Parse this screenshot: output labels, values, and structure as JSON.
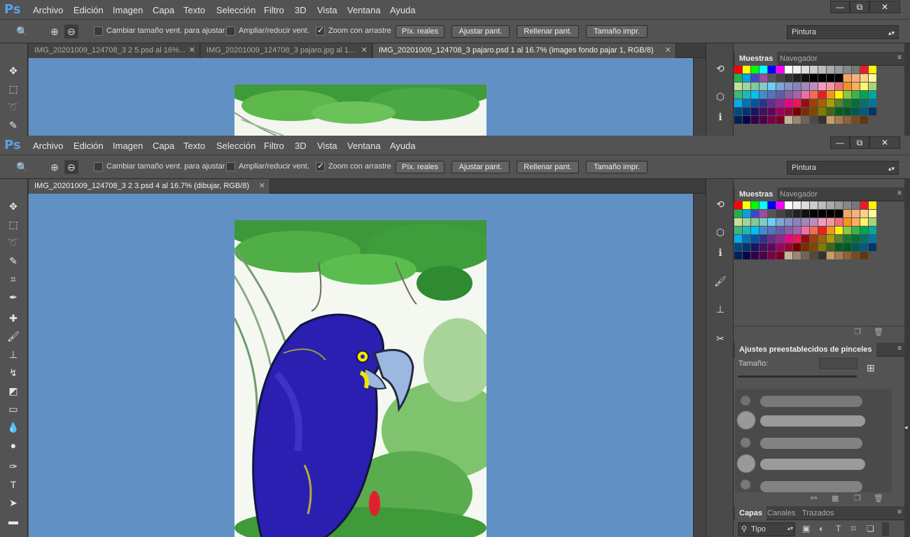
{
  "app": {
    "logo": "Ps"
  },
  "menu": [
    "Archivo",
    "Edición",
    "Imagen",
    "Capa",
    "Texto",
    "Selección",
    "Filtro",
    "3D",
    "Vista",
    "Ventana",
    "Ayuda"
  ],
  "window_buttons": {
    "minimize": "—",
    "restore": "⧉",
    "close": "✕"
  },
  "options": {
    "resize_windows": "Cambiar tamaño vent. para ajustar",
    "zoom_all": "Ampliar/reducir vent.",
    "scrubby_zoom": "Zoom con arrastre",
    "actual_pixels": "Píx. reales",
    "fit_screen": "Ajustar pant.",
    "fill_screen": "Rellenar pant.",
    "print_size": "Tamaño impr.",
    "workspace": "Pintura"
  },
  "back_window": {
    "tabs": [
      {
        "label": "IMG_20201009_124708_3 2 5.psd al 16%...",
        "active": false
      },
      {
        "label": "IMG_20201009_124708_3 pajaro.jpg al 1...",
        "active": false
      },
      {
        "label": "IMG_20201009_124708_3 pajaro.psd 1 al 16.7% (images fondo pajar 1, RGB/8)",
        "active": true
      }
    ]
  },
  "front_window": {
    "tabs": [
      {
        "label": "IMG_20201009_124708_3 2 3.psd 4 al 16.7% (dibujar, RGB/8)",
        "active": true
      }
    ]
  },
  "panels": {
    "swatches_tab": "Muestras",
    "navigator_tab": "Navegador",
    "brush_presets_title": "Ajustes preestablecidos de pinceles",
    "size_label": "Tamaño:",
    "layers_tab": "Capas",
    "channels_tab": "Canales",
    "paths_tab": "Trazados",
    "kind_filter": "Tipo"
  },
  "colors": {
    "ui_bg": "#535353",
    "canvas_bg": "#6190c4",
    "accent_logo": "#5aa0e6"
  },
  "swatches": [
    [
      "#ff0000",
      "#ffff00",
      "#00ff00",
      "#00ffff",
      "#0000ff",
      "#ff00ff",
      "#ffffff",
      "#eeeeee",
      "#dddddd",
      "#cccccc",
      "#bbbbbb",
      "#aaaaaa",
      "#999999",
      "#888888",
      "#777777",
      "#ed1c24",
      "#fff200"
    ],
    [
      "#22b14c",
      "#00a2e8",
      "#3f48cc",
      "#a349a4",
      "#555555",
      "#444444",
      "#333333",
      "#222222",
      "#111111",
      "#000000",
      "#000000",
      "#000000",
      "#000000",
      "#f4a460",
      "#fbb07c",
      "#fdd38a",
      "#fff799"
    ],
    [
      "#c4df9b",
      "#a2d39c",
      "#82ca9d",
      "#7bcdc8",
      "#6ecff6",
      "#7ea7d8",
      "#8493ca",
      "#8882be",
      "#a187be",
      "#bc8dbf",
      "#f49ac1",
      "#f5989d",
      "#f26d7d",
      "#f7941d",
      "#fbaf5d",
      "#fff568",
      "#acd373"
    ],
    [
      "#3cb878",
      "#1abbb4",
      "#00bff3",
      "#438ccb",
      "#5574b9",
      "#605ca8",
      "#855fa8",
      "#a763a8",
      "#f06ea9",
      "#f26c4f",
      "#ed1c24",
      "#f7941d",
      "#fff200",
      "#8dc73f",
      "#39b54a",
      "#00a651",
      "#00a99d"
    ],
    [
      "#00aeef",
      "#0072bc",
      "#0054a6",
      "#2e3192",
      "#662d91",
      "#92278f",
      "#ec008c",
      "#ed145b",
      "#9e0b0f",
      "#a0410d",
      "#a36209",
      "#aba000",
      "#598527",
      "#197b30",
      "#007236",
      "#00746b",
      "#0076a3"
    ],
    [
      "#004a80",
      "#003471",
      "#1b1464",
      "#440e62",
      "#630460",
      "#9e005d",
      "#9e0039",
      "#790000",
      "#7b2e00",
      "#7d4900",
      "#827b00",
      "#406618",
      "#005e20",
      "#005826",
      "#005952",
      "#005b7f",
      "#003663"
    ],
    [
      "#002157",
      "#0d004c",
      "#32004b",
      "#4b0049",
      "#7b0046",
      "#7a0026",
      "#c7b299",
      "#998675",
      "#736357",
      "#534741",
      "#37302d",
      "#c69c6d",
      "#a67c52",
      "#8c6239",
      "#754c24",
      "#603913"
    ]
  ]
}
